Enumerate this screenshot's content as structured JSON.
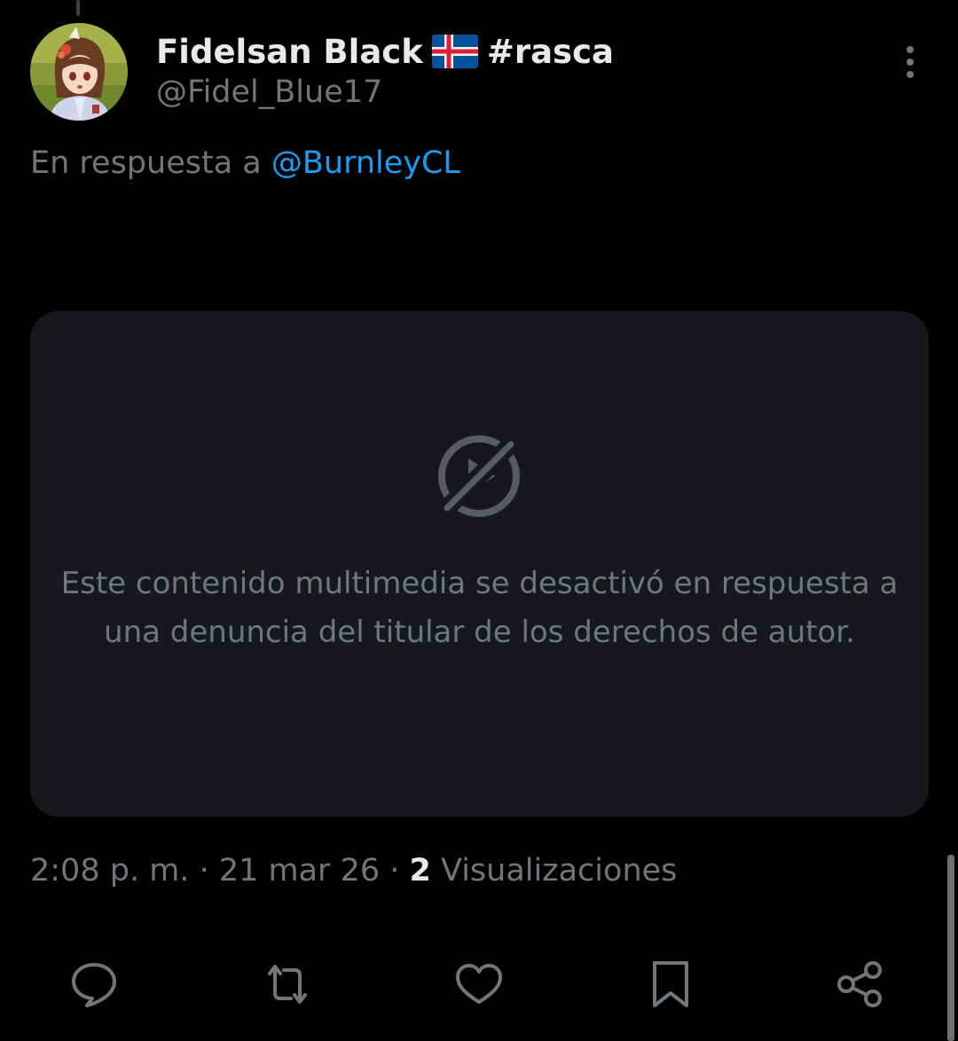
{
  "tweet": {
    "author": {
      "display_name": "Fidelsan Black",
      "flag_icon": "iceland-flag-icon",
      "hashtag": "#rasca",
      "handle": "@Fidel_Blue17"
    },
    "reply_prefix": "En respuesta a",
    "reply_to": "@BurnleyCL",
    "media": {
      "icon": "media-disabled-icon",
      "message": "Este contenido multimedia se desactivó en respuesta a una denuncia del titular de los derechos de autor."
    },
    "meta": {
      "time": "2:08 p. m.",
      "separator": "·",
      "date": "21 mar 26",
      "views_count": "2",
      "views_label": "Visualizaciones"
    },
    "actions": [
      {
        "name": "reply-icon"
      },
      {
        "name": "retweet-icon"
      },
      {
        "name": "like-icon"
      },
      {
        "name": "bookmark-icon"
      },
      {
        "name": "share-icon"
      }
    ]
  },
  "colors": {
    "background": "#000000",
    "primary_text": "#e7e9ea",
    "secondary_text": "#71767b",
    "accent": "#1d9bf0",
    "card_background": "#16181c"
  }
}
